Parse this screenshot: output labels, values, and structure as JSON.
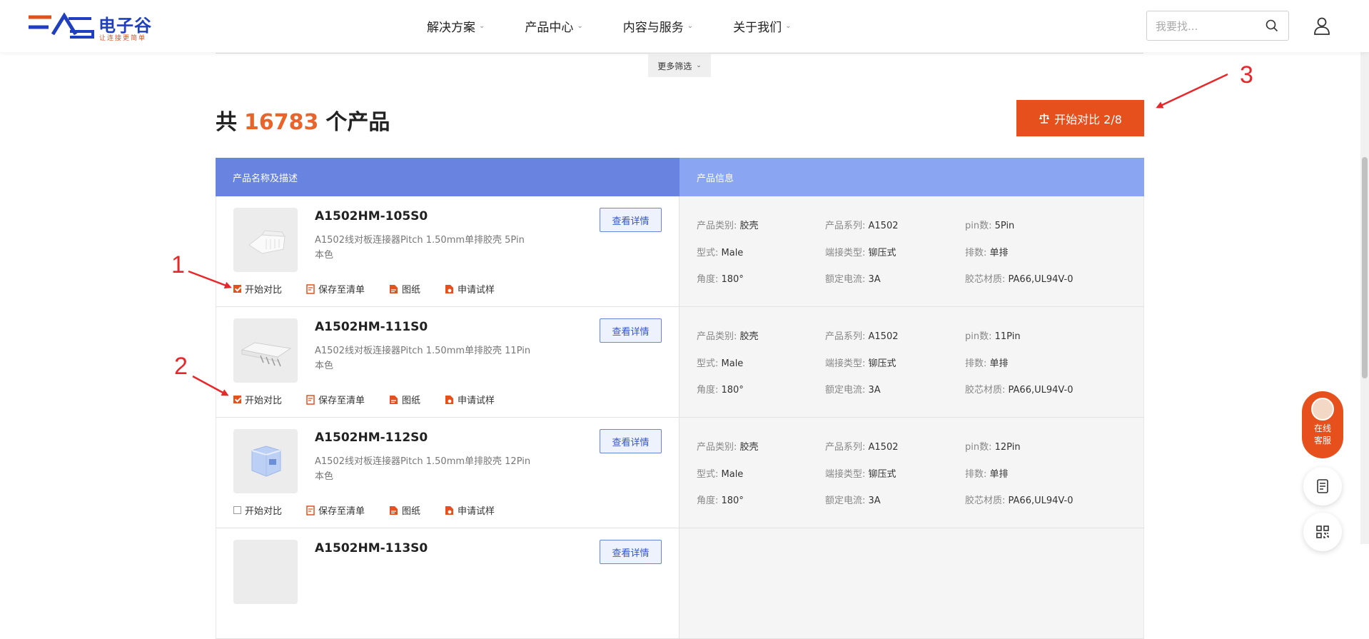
{
  "header": {
    "logo_text": "电子谷",
    "logo_slogan": "让连接更简单",
    "nav": [
      {
        "label": "解决方案"
      },
      {
        "label": "产品中心"
      },
      {
        "label": "内容与服务"
      },
      {
        "label": "关于我们"
      }
    ],
    "search_placeholder": "我要找..."
  },
  "filter": {
    "more_label": "更多筛选"
  },
  "summary": {
    "prefix": "共",
    "count": "16783",
    "suffix": "个产品"
  },
  "compare_button": "开始对比 2/8",
  "table": {
    "headers": [
      "产品名称及描述",
      "产品信息"
    ],
    "detail_label": "查看详情",
    "actions": {
      "compare": "开始对比",
      "save": "保存至清单",
      "drawing": "图纸",
      "sample": "申请试样"
    },
    "rows": [
      {
        "name": "A1502HM-105S0",
        "desc": "A1502线对板连接器Pitch 1.50mm单排胶壳 5Pin",
        "color": "本色",
        "checked": true,
        "info": {
          "category": "产品类别: ",
          "category_v": "胶壳",
          "series": "产品系列: ",
          "series_v": "A1502",
          "pins": "pin数: ",
          "pins_v": "5Pin",
          "type": "型式: ",
          "type_v": "Male",
          "terminal": "端接类型: ",
          "terminal_v": "铆压式",
          "rows": "排数: ",
          "rows_v": "单排",
          "angle": "角度: ",
          "angle_v": "180°",
          "current": "额定电流: ",
          "current_v": "3A",
          "material": "胶芯材质: ",
          "material_v": "PA66,UL94V-0"
        }
      },
      {
        "name": "A1502HM-111S0",
        "desc": "A1502线对板连接器Pitch 1.50mm单排胶壳 11Pin",
        "color": "本色",
        "checked": true,
        "info": {
          "category": "产品类别: ",
          "category_v": "胶壳",
          "series": "产品系列: ",
          "series_v": "A1502",
          "pins": "pin数: ",
          "pins_v": "11Pin",
          "type": "型式: ",
          "type_v": "Male",
          "terminal": "端接类型: ",
          "terminal_v": "铆压式",
          "rows": "排数: ",
          "rows_v": "单排",
          "angle": "角度: ",
          "angle_v": "180°",
          "current": "额定电流: ",
          "current_v": "3A",
          "material": "胶芯材质: ",
          "material_v": "PA66,UL94V-0"
        }
      },
      {
        "name": "A1502HM-112S0",
        "desc": "A1502线对板连接器Pitch 1.50mm单排胶壳 12Pin",
        "color": "本色",
        "checked": false,
        "info": {
          "category": "产品类别: ",
          "category_v": "胶壳",
          "series": "产品系列: ",
          "series_v": "A1502",
          "pins": "pin数: ",
          "pins_v": "12Pin",
          "type": "型式: ",
          "type_v": "Male",
          "terminal": "端接类型: ",
          "terminal_v": "铆压式",
          "rows": "排数: ",
          "rows_v": "单排",
          "angle": "角度: ",
          "angle_v": "180°",
          "current": "额定电流: ",
          "current_v": "3A",
          "material": "胶芯材质: ",
          "material_v": "PA66,UL94V-0"
        }
      },
      {
        "name": "A1502HM-113S0",
        "desc": "",
        "color": "",
        "checked": false,
        "info": {}
      }
    ]
  },
  "float": {
    "service_line1": "在线",
    "service_line2": "客服"
  },
  "annotations": [
    "1",
    "2",
    "3"
  ],
  "colors": {
    "accent": "#e6501c",
    "header_left": "#6884e0",
    "header_right": "#8aa6f3",
    "annotation": "#e8272b"
  }
}
